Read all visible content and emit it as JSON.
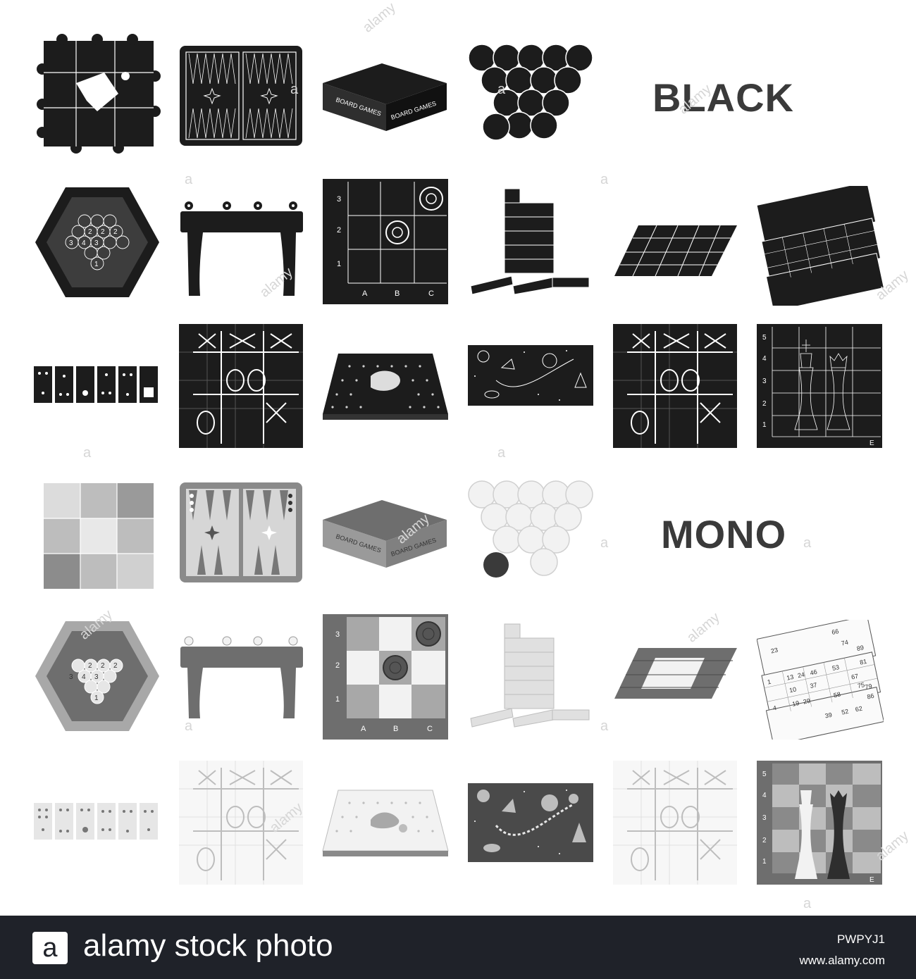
{
  "headings": {
    "black": "BLACK",
    "mono": "MONO"
  },
  "tic_tac_toe_black_1": {
    "o1": "O",
    "o2": "O",
    "x1": "X"
  },
  "hex_board": {
    "row1": [
      "2",
      "2",
      "2"
    ],
    "row2": [
      "3",
      "4",
      "3"
    ],
    "center": "1"
  },
  "checkers_board_black": {
    "rows": [
      "3",
      "2",
      "1"
    ],
    "cols": [
      "A",
      "B",
      "C"
    ]
  },
  "checkers_board_mono": {
    "rows": [
      "3",
      "2",
      "1"
    ],
    "cols": [
      "A",
      "B",
      "C"
    ]
  },
  "chess_board_black": {
    "rows": [
      "5",
      "4",
      "3",
      "2",
      "1"
    ],
    "col": "E"
  },
  "chess_board_mono": {
    "rows": [
      "5",
      "4",
      "3",
      "2",
      "1"
    ],
    "col": "E"
  },
  "lotto_mono": {
    "row1": [
      "1",
      "13",
      "24",
      "46",
      "53",
      "81"
    ],
    "row2": [
      "10",
      "37",
      "67"
    ],
    "row3": [
      "4",
      "19",
      "29",
      "58",
      "75"
    ],
    "top": [
      "23",
      "66",
      "74",
      "89"
    ],
    "bottom": [
      "39",
      "52",
      "62",
      "86",
      "79"
    ]
  },
  "board_games_box": {
    "label": "BOARD GAMES"
  },
  "watermark": {
    "text": "alamy",
    "letter": "a"
  },
  "footer": {
    "logo_letter": "a",
    "brand": "alamy stock photo",
    "image_id": "PWPYJ1",
    "url": "www.alamy.com"
  }
}
